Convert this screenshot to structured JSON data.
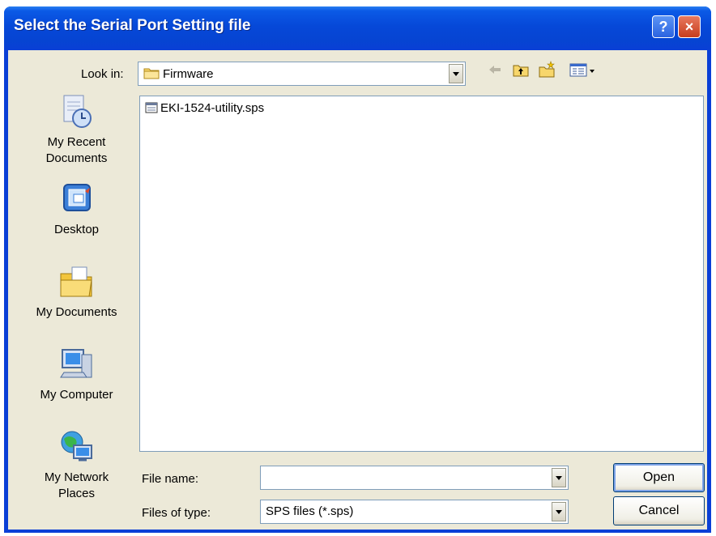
{
  "window": {
    "title": "Select the Serial Port Setting file",
    "help_glyph": "?",
    "close_glyph": "×"
  },
  "lookin": {
    "label": "Look in:",
    "value": "Firmware"
  },
  "toolbar": {
    "icons": [
      "back-arrow-icon",
      "up-folder-icon",
      "new-folder-icon",
      "view-menu-icon"
    ]
  },
  "places": [
    {
      "label1": "My Recent",
      "label2": "Documents",
      "icon": "recent-documents-icon"
    },
    {
      "label1": "Desktop",
      "label2": "",
      "icon": "desktop-icon"
    },
    {
      "label1": "My Documents",
      "label2": "",
      "icon": "my-documents-icon"
    },
    {
      "label1": "My Computer",
      "label2": "",
      "icon": "my-computer-icon"
    },
    {
      "label1": "My Network",
      "label2": "Places",
      "icon": "network-places-icon"
    }
  ],
  "files": [
    {
      "name": "EKI-1524-utility.sps",
      "icon": "sps-file-icon"
    }
  ],
  "filename": {
    "label": "File name:",
    "value": ""
  },
  "filetype": {
    "label": "Files of type:",
    "value": "SPS files (*.sps)"
  },
  "buttons": {
    "open": "Open",
    "cancel": "Cancel"
  },
  "colors": {
    "titlebar": "#0648d8",
    "dialog_bg": "#ece9d8",
    "close": "#c73d1d"
  }
}
